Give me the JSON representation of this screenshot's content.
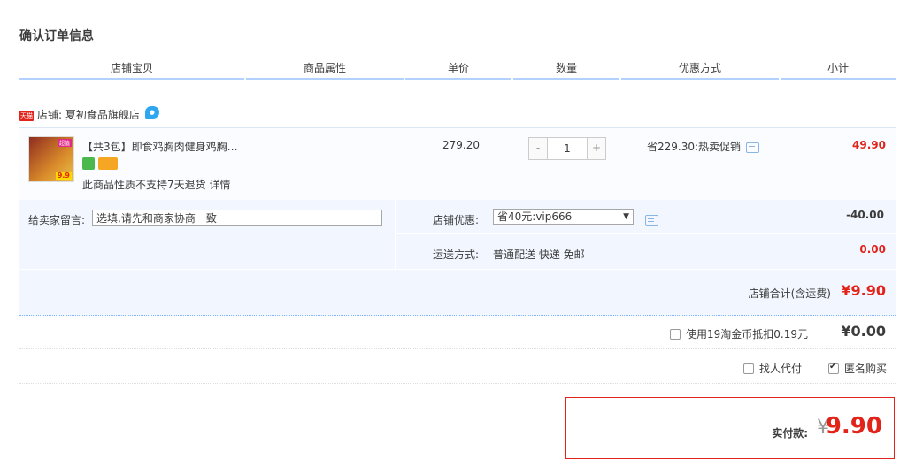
{
  "page": {
    "title": "确认订单信息"
  },
  "columns": [
    "店铺宝贝",
    "商品属性",
    "单价",
    "数量",
    "优惠方式",
    "小计"
  ],
  "shop": {
    "badge": "天猫",
    "label": "店铺: 夏初食品旗舰店"
  },
  "item": {
    "name": "【共3包】即食鸡胸肉健身鸡胸…",
    "thumb_badge": "9.9",
    "thumb_tag": "超值",
    "notice": "此商品性质不支持7天退货 详情",
    "unit_price": "279.20",
    "quantity": "1",
    "minus": "-",
    "plus": "+",
    "promo": "省229.30:热卖促销",
    "subtotal": "49.90"
  },
  "options": {
    "message_label": "给卖家留言:",
    "message_placeholder": "选填,请先和商家协商一致",
    "coupon_label": "店铺优惠:",
    "coupon_value": "省40元:vip666",
    "coupon_amount": "-40.00",
    "shipping_label": "运送方式:",
    "shipping_value": "普通配送 快递 免邮",
    "shipping_amount": "0.00"
  },
  "shop_total": {
    "label": "店铺合计(含运费)",
    "amount": "¥9.90"
  },
  "coins": {
    "label": "使用19淘金币抵扣0.19元",
    "amount": "¥0.00",
    "checked": false
  },
  "proxy_pay": {
    "label": "找人代付",
    "checked": false
  },
  "anonymous": {
    "label": "匿名购买",
    "checked": true
  },
  "payment": {
    "label": "实付款:",
    "currency": "¥",
    "amount": "9.90"
  },
  "colors": {
    "accent": "#e2231a",
    "header_border": "#b2d1ff",
    "panel": "#f2f7ff"
  }
}
